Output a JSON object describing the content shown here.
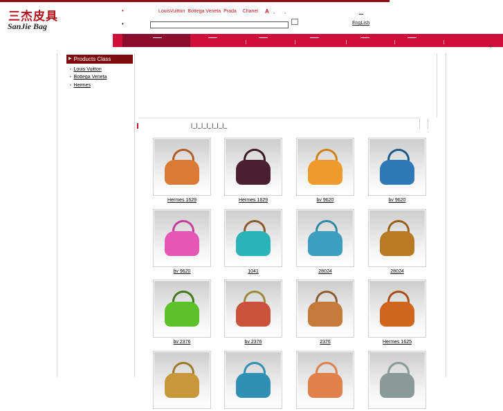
{
  "header": {
    "logo_cn": "三杰皮具",
    "logo_en": "SanJie Bag",
    "bullet": "•",
    "brand_links": [
      "LouisVuitton",
      "Bottega Veneta",
      "Prada",
      "Chanel"
    ],
    "brand_a": "A",
    "comma": ",",
    "search_value": "",
    "english_label": "EngLish"
  },
  "sidebar": {
    "title": "Products Class",
    "items": [
      {
        "label": "Louis Vuitton"
      },
      {
        "label": "Bottega Veneta"
      },
      {
        "label": "Hermes"
      }
    ]
  },
  "pager": {
    "current": "",
    "text": "|_|_|_|_|_|_|_"
  },
  "products": [
    {
      "caption": "Hermes 1629",
      "color": "#d97a35",
      "handle": "#b35c22"
    },
    {
      "caption": "Hermes 1629",
      "color": "#4a2030",
      "handle": "#3a1824"
    },
    {
      "caption": "bv 9620",
      "color": "#ef9a2c",
      "handle": "#d57e12"
    },
    {
      "caption": "bv 9620",
      "color": "#2f79b6",
      "handle": "#1d5a8c"
    },
    {
      "caption": "bv 9620",
      "color": "#e457b4",
      "handle": "#c43d97"
    },
    {
      "caption": "1041",
      "color": "#2ab3b8",
      "handle": "#8a5a2b"
    },
    {
      "caption": "28024",
      "color": "#3d9fbf",
      "handle": "#2f86a4"
    },
    {
      "caption": "28024",
      "color": "#b97a26",
      "handle": "#9a5f16"
    },
    {
      "caption": "bv 2376",
      "color": "#5cc22a",
      "handle": "#3e7a1a"
    },
    {
      "caption": "bv 2376",
      "color": "#c9523c",
      "handle": "#9c8a3a"
    },
    {
      "caption": "2376",
      "color": "#c47a3a",
      "handle": "#8a5c2c"
    },
    {
      "caption": "Hermes 1625",
      "color": "#d0661c",
      "handle": "#a84e12"
    },
    {
      "caption": "",
      "color": "#c7973a",
      "handle": "#a07828"
    },
    {
      "caption": "",
      "color": "#2f8fb5",
      "handle": "#2f8fb5"
    },
    {
      "caption": "",
      "color": "#e0804a",
      "handle": "#e0804a"
    },
    {
      "caption": "",
      "color": "#8a9a98",
      "handle": "#8a9a98"
    }
  ]
}
